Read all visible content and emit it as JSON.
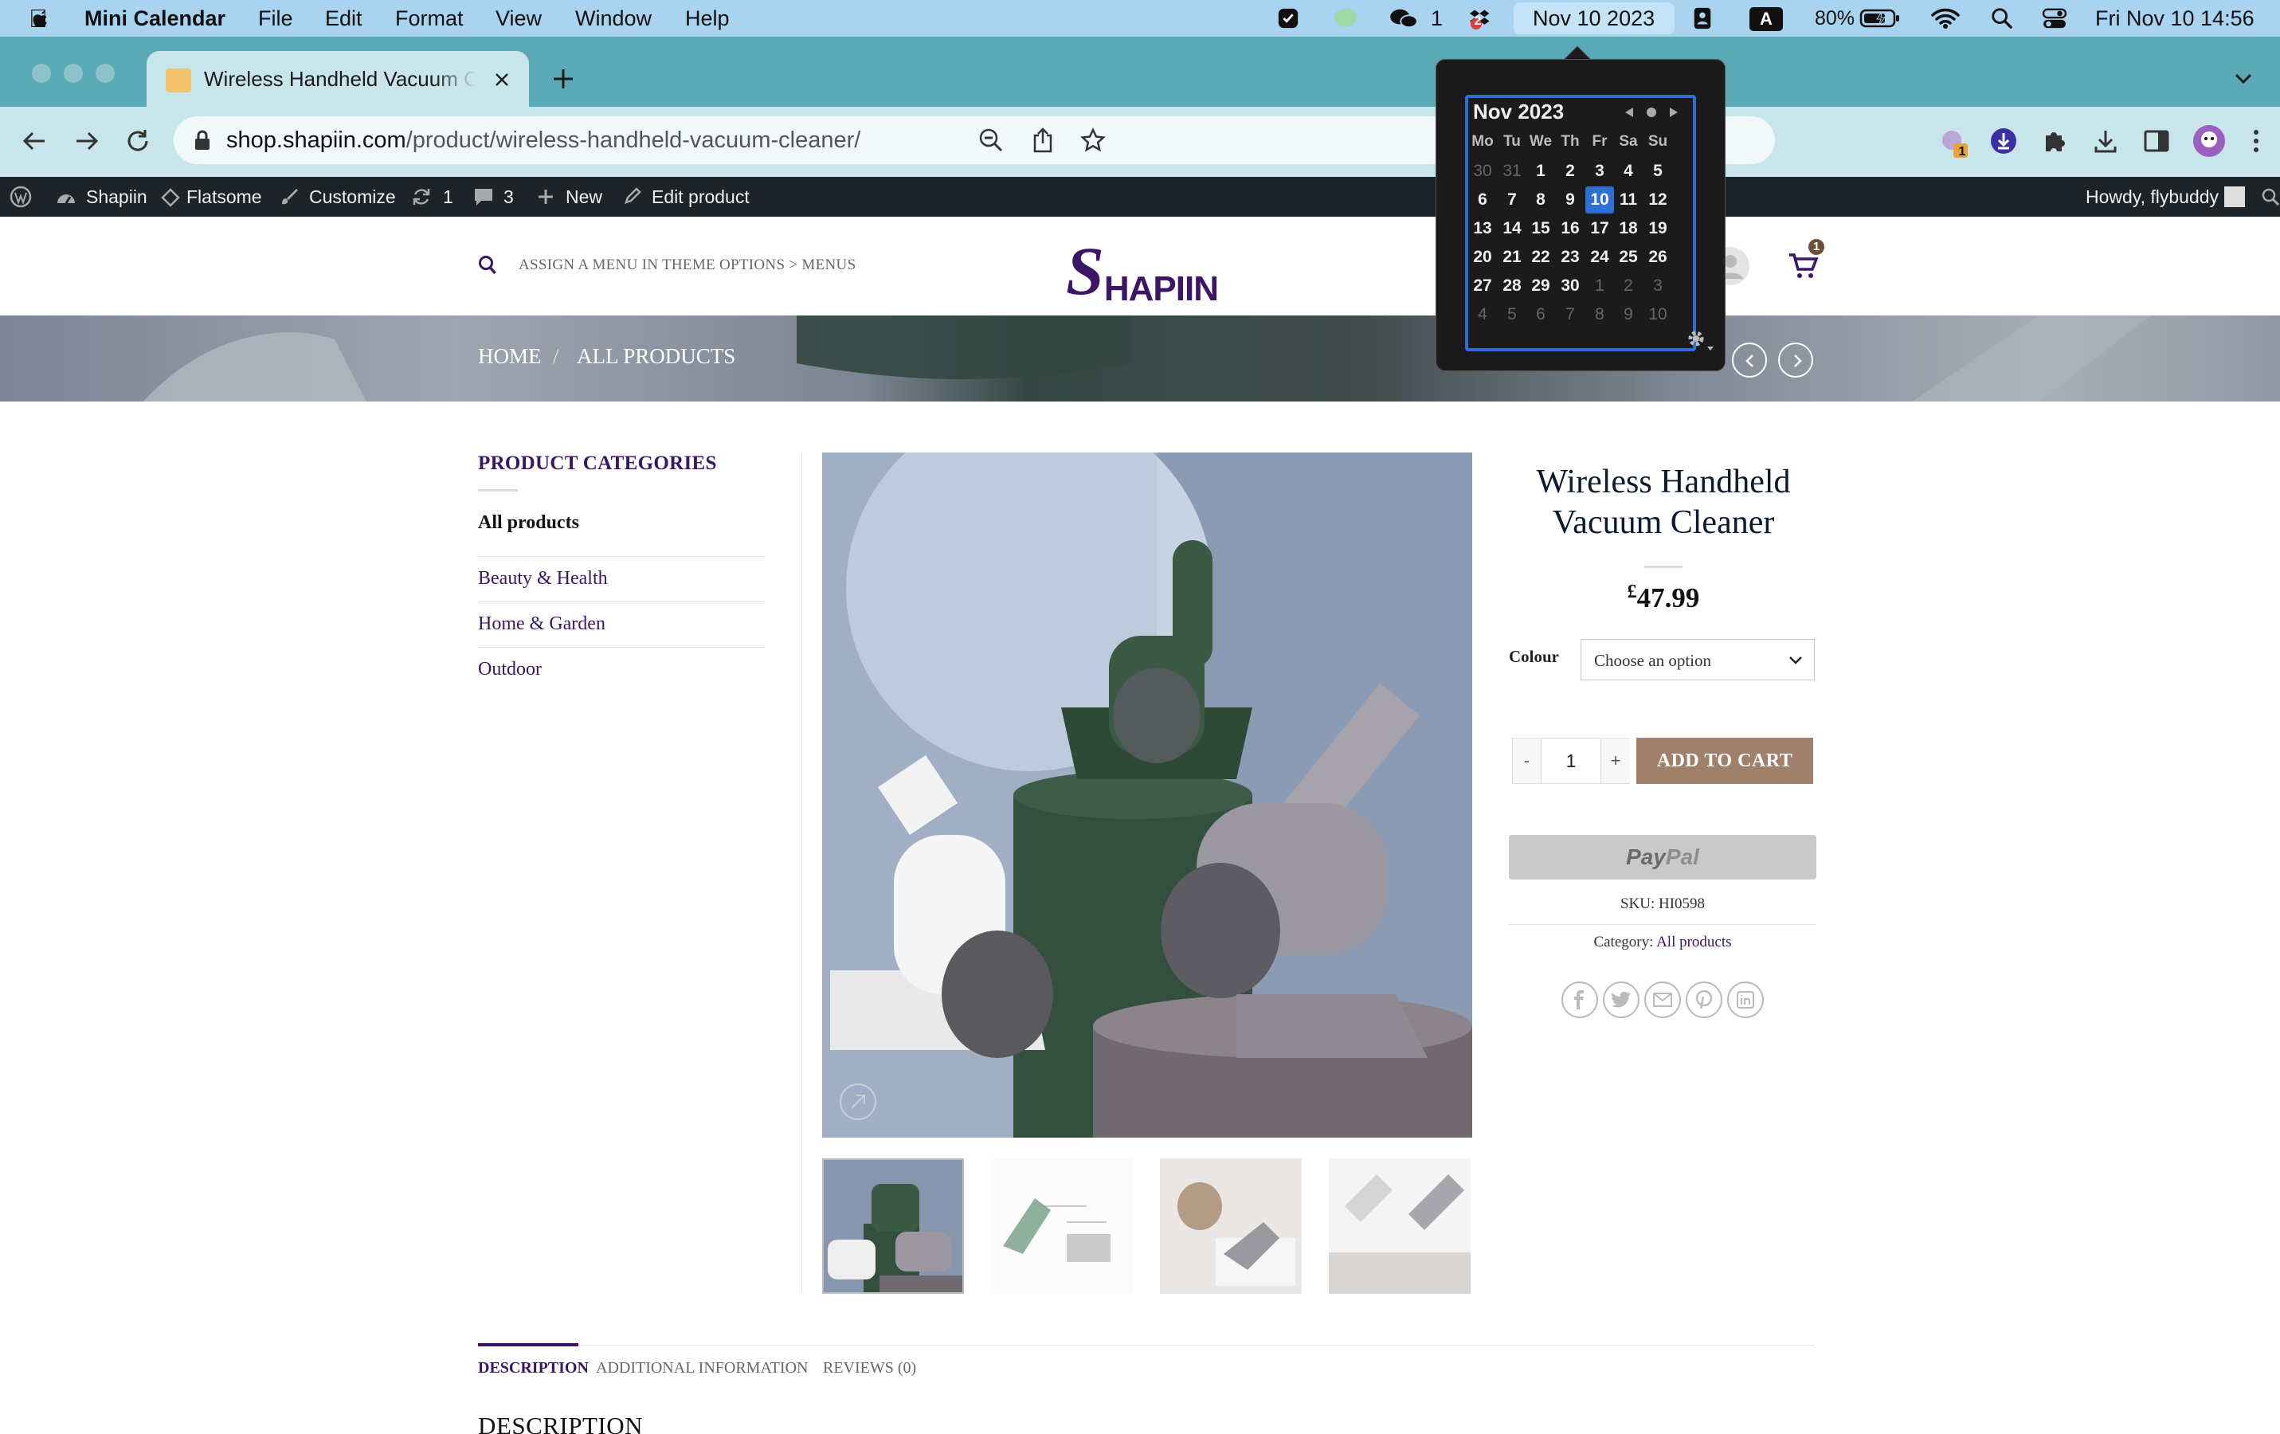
{
  "menubar": {
    "app_name": "Mini Calendar",
    "menus": [
      "File",
      "Edit",
      "Format",
      "View",
      "Window",
      "Help"
    ],
    "wechat_count": "1",
    "dropbox_badge": "2",
    "date_pill": "Nov 10 2023",
    "input_source": "A",
    "battery_pct": "80%",
    "clock": "Fri Nov 10  14:56"
  },
  "browser": {
    "tab_title": "Wireless Handheld Vacuum Cleaner",
    "url_host": "shop.shapiin.com",
    "url_path": "/product/wireless-handheld-vacuum-cleaner/",
    "ext_badge": "1"
  },
  "wpadmin": {
    "site": "Shapiin",
    "theme": "Flatsome",
    "customize": "Customize",
    "updates": "1",
    "comments": "3",
    "new": "New",
    "edit": "Edit product",
    "howdy": "Howdy, flybuddy"
  },
  "header": {
    "menu_hint": "ASSIGN A MENU IN THEME OPTIONS > MENUS",
    "logo_s": "S",
    "logo_rest": "HAPIIN",
    "cart_count": "1"
  },
  "breadcrumb": {
    "home": "HOME",
    "sep": "/",
    "current": "ALL PRODUCTS"
  },
  "sidebar": {
    "title": "PRODUCT CATEGORIES",
    "items": [
      {
        "label": "All products"
      },
      {
        "label": "Beauty & Health"
      },
      {
        "label": "Home & Garden"
      },
      {
        "label": "Outdoor"
      }
    ]
  },
  "product": {
    "title_line1": "Wireless Handheld",
    "title_line2": "Vacuum Cleaner",
    "currency": "£",
    "price": "47.99",
    "colour_label": "Colour",
    "colour_placeholder": "Choose an option",
    "qty_minus": "-",
    "qty": "1",
    "qty_plus": "+",
    "add_to_cart": "ADD TO CART",
    "paypal_a": "Pay",
    "paypal_b": "Pal",
    "sku_label": "SKU:",
    "sku": "HI0598",
    "category_label": "Category:",
    "category": "All products"
  },
  "tabs": {
    "description": "DESCRIPTION",
    "additional": "ADDITIONAL INFORMATION",
    "reviews": "REVIEWS (0)"
  },
  "description_heading": "DESCRIPTION",
  "calendar": {
    "month": "Nov 2023",
    "weekdays": [
      "Mo",
      "Tu",
      "We",
      "Th",
      "Fr",
      "Sa",
      "Su"
    ],
    "weeks": [
      [
        "30",
        "31",
        "1",
        "2",
        "3",
        "4",
        "5"
      ],
      [
        "6",
        "7",
        "8",
        "9",
        "10",
        "11",
        "12"
      ],
      [
        "13",
        "14",
        "15",
        "16",
        "17",
        "18",
        "19"
      ],
      [
        "20",
        "21",
        "22",
        "23",
        "24",
        "25",
        "26"
      ],
      [
        "27",
        "28",
        "29",
        "30",
        "1",
        "2",
        "3"
      ],
      [
        "4",
        "5",
        "6",
        "7",
        "8",
        "9",
        "10"
      ]
    ],
    "today": "10"
  },
  "colors": {
    "accent_purple": "#3c1564",
    "cart_button": "#a0806a",
    "calendar_highlight": "#2e6fd4"
  }
}
